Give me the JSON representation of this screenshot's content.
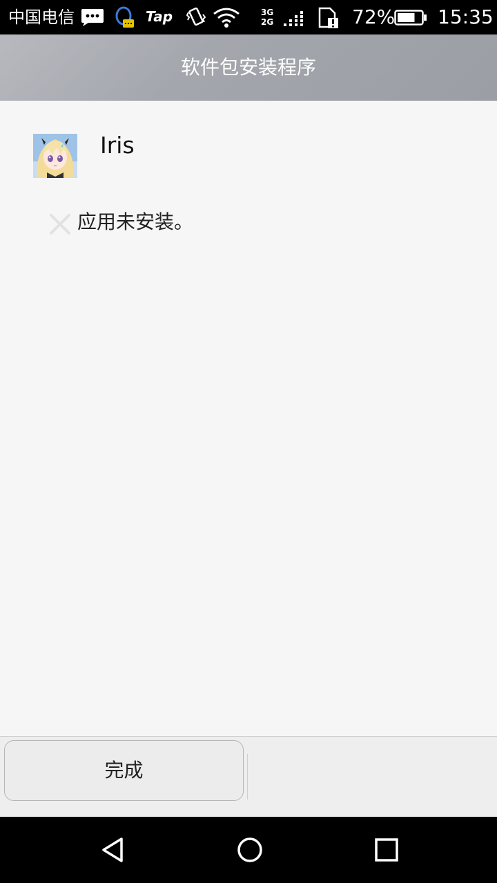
{
  "status_bar": {
    "carrier": "中国电信",
    "tap_label": "Tap",
    "network_type_top": "3G",
    "network_type_bottom": "2G",
    "battery_percent": "72%",
    "battery_level": 0.72,
    "time": "15:35",
    "icons": [
      "message-icon",
      "qq-icon",
      "tap-icon",
      "vibrate-icon",
      "wifi-icon",
      "signal-icon",
      "sim-alert-icon",
      "battery-icon"
    ]
  },
  "title_bar": {
    "title": "软件包安装程序"
  },
  "app": {
    "name": "Iris",
    "icon": "app-avatar-icon"
  },
  "install_status": {
    "icon": "close-icon",
    "message": "应用未安装。"
  },
  "actions": {
    "done_label": "完成"
  },
  "nav_bar": {
    "icons": [
      "back-icon",
      "home-icon",
      "recents-icon"
    ]
  }
}
